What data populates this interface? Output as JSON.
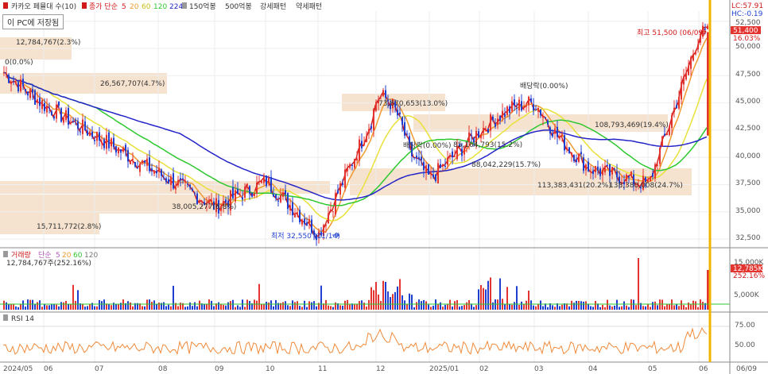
{
  "header": {
    "title": "카카오 페뮬대 수(10)",
    "ma_label": "종가 단순",
    "ma_periods": [
      "5",
      "20",
      "60",
      "120",
      "224"
    ],
    "pattern_labels": [
      "150억봉",
      "500억봉",
      "강세패턴",
      "약세패턴"
    ],
    "right_top": [
      "LC:57.91",
      "HC:-0.19"
    ]
  },
  "tooltip": "이 PC에 저장됨",
  "price_panel": {
    "yaxis": [
      "52,500",
      "50,000",
      "47,500",
      "45,000",
      "42,500",
      "40,000",
      "37,500",
      "35,000",
      "32,500"
    ],
    "annotations": [
      "12,784,767(2.3%)",
      "0(0.0%)",
      "26,567,707(4.7%)",
      "38,005,277(6.8%)",
      "15,711,772(2.8%)",
      "최저 32,550 (11/14)",
      "73,870,653(13.0%)",
      "배당락(0.00%)",
      "85,164,793(15.2%)",
      "88,042,229(15.7%)",
      "113,383,431(20.2%)",
      "배당락(0.00%)",
      "108,793,469(19.4%)",
      "138,380,008(24.7%)",
      "최고 51,500 (06/09)"
    ],
    "last_price": "51,400",
    "last_change": "16.03%"
  },
  "volume_panel": {
    "header_name": "거래량",
    "ma_label": "단순",
    "ma_periods": [
      "5",
      "20",
      "60",
      "120"
    ],
    "value_text": "12,784,767주(252.16%)",
    "yaxis": [
      "15,000K",
      "5,000K"
    ],
    "last": "12,785K",
    "last_pct": "252.16%"
  },
  "rsi_panel": {
    "label": "RSI 14",
    "yaxis": [
      "75.00",
      "50.00"
    ]
  },
  "xaxis": [
    "2024/05",
    "06",
    "07",
    "08",
    "09",
    "10",
    "11",
    "12",
    "2025/01",
    "02",
    "03",
    "04",
    "05",
    "06",
    "06/09"
  ],
  "colors": {
    "up": "#e3342f",
    "down": "#1f3fd1",
    "ma5": "#d11a1a",
    "ma20": "#f09a30",
    "ma60": "#e9e13a",
    "ma120": "#2ec82e",
    "ma224": "#2424c8",
    "band": "#f5e3cf",
    "cursor": "#f0b400",
    "rsi": "#f08a3a"
  },
  "chart_data": {
    "type": "candlestick",
    "x_months": [
      "2024/05",
      "06",
      "07",
      "08",
      "09",
      "10",
      "11",
      "12",
      "2025/01",
      "02",
      "03",
      "04",
      "05",
      "06"
    ],
    "y_range": [
      31500,
      53500
    ],
    "key_closes": [
      {
        "x": "2024/05",
        "close": 47800
      },
      {
        "x": "06",
        "close": 44800
      },
      {
        "x": "07",
        "close": 42000
      },
      {
        "x": "08",
        "close": 38500
      },
      {
        "x": "09",
        "close": 35500
      },
      {
        "x": "10",
        "close": 37800
      },
      {
        "x": "11",
        "close": 33000
      },
      {
        "x": "12",
        "close": 44500
      },
      {
        "x": "2025/01",
        "close": 38000
      },
      {
        "x": "02",
        "close": 42500
      },
      {
        "x": "03",
        "close": 44000
      },
      {
        "x": "04",
        "close": 39000
      },
      {
        "x": "05",
        "close": 37500
      },
      {
        "x": "06",
        "close": 51400
      }
    ],
    "min": {
      "date": "11/14",
      "value": 32550
    },
    "max": {
      "date": "06/09",
      "value": 51500
    }
  }
}
